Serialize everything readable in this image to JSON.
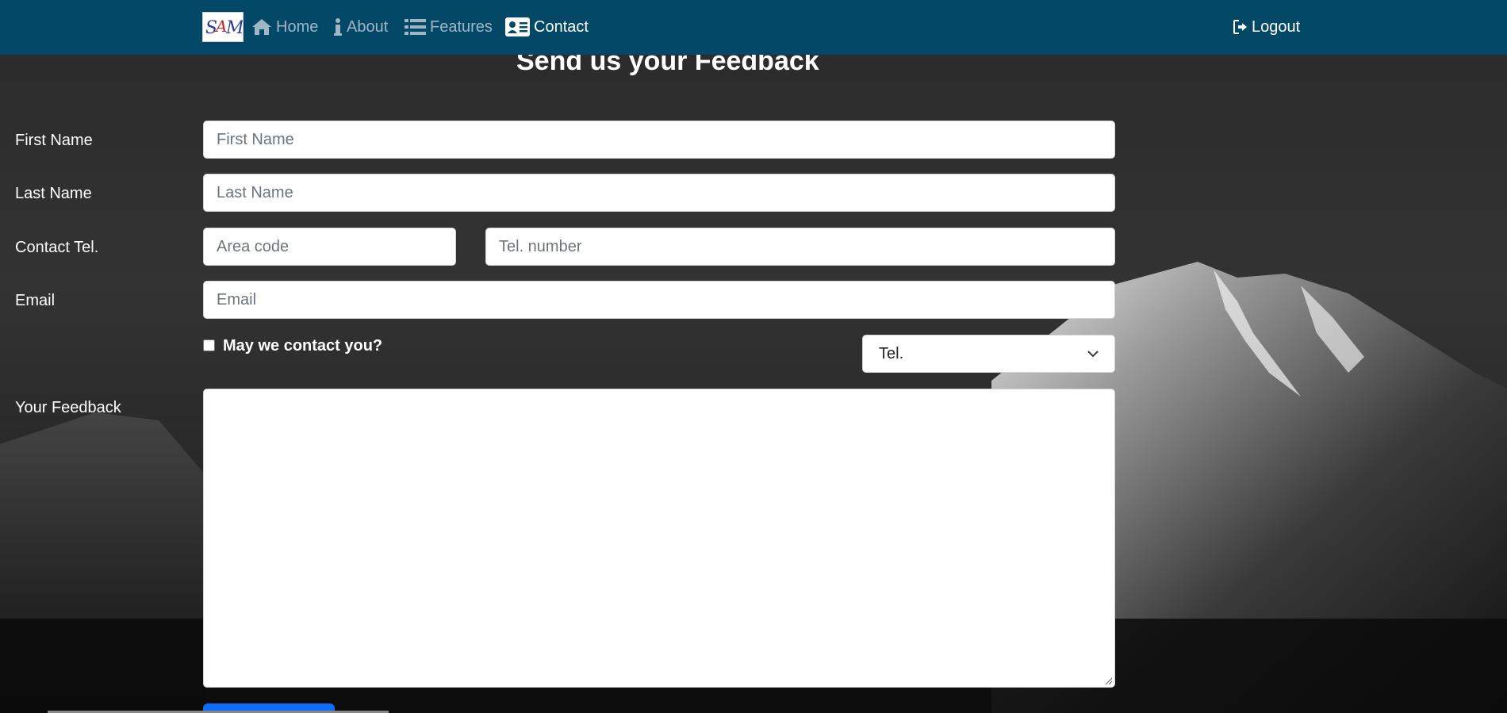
{
  "nav": {
    "brand_alt": "SAM",
    "items": [
      {
        "label": "Home",
        "icon": "home-icon"
      },
      {
        "label": "About",
        "icon": "info-icon"
      },
      {
        "label": "Features",
        "icon": "list-icon"
      },
      {
        "label": "Contact",
        "icon": "contact-card-icon",
        "active": true
      }
    ],
    "logout_label": "Logout"
  },
  "form": {
    "title": "Send us your Feedback",
    "first_name": {
      "label": "First Name",
      "placeholder": "First Name"
    },
    "last_name": {
      "label": "Last Name",
      "placeholder": "Last Name"
    },
    "tel": {
      "label": "Contact Tel.",
      "area_placeholder": "Area code",
      "number_placeholder": "Tel. number"
    },
    "email": {
      "label": "Email",
      "placeholder": "Email"
    },
    "contact_checkbox_label": "May we contact you?",
    "contact_method": {
      "selected": "Tel."
    },
    "feedback": {
      "label": "Your Feedback"
    }
  },
  "colors": {
    "navbar": "#044868",
    "nav_inactive": "#9fb6c4",
    "nav_active": "#ffffff",
    "primary_button": "#0d6efd"
  }
}
